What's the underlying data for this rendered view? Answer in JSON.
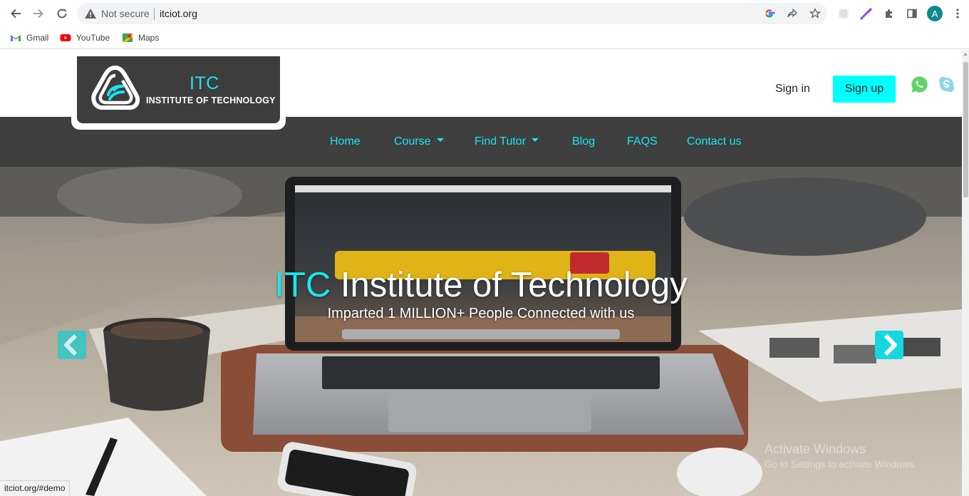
{
  "browser": {
    "not_secure_label": "Not secure",
    "url": "itciot.org",
    "avatar_initial": "A",
    "bookmarks": [
      {
        "label": "Gmail",
        "icon": "gmail-icon"
      },
      {
        "label": "YouTube",
        "icon": "youtube-icon"
      },
      {
        "label": "Maps",
        "icon": "maps-icon"
      }
    ],
    "status_url": "itciot.org/#demo"
  },
  "site": {
    "logo": {
      "title": "ITC",
      "subtitle": "INSTITUTE OF TECHNOLOGY"
    },
    "header": {
      "signin_label": "Sign in",
      "signup_label": "Sign up"
    },
    "nav": [
      {
        "label": "Home",
        "dropdown": false
      },
      {
        "label": "Course",
        "dropdown": true
      },
      {
        "label": "Find Tutor",
        "dropdown": true
      },
      {
        "label": "Blog",
        "dropdown": false
      },
      {
        "label": "FAQS",
        "dropdown": false
      },
      {
        "label": "Contact us",
        "dropdown": false
      }
    ],
    "hero": {
      "title_accent": "ITC",
      "title_rest": " Institute of Technology",
      "subtitle": "Imparted 1 MILLION+ People Connected with us"
    },
    "colors": {
      "accent": "#19e6f0",
      "signup_bg": "#00ffff",
      "navbar_bg": "#3f3f3f",
      "logo_bg": "#3e3d3d"
    }
  },
  "os": {
    "activate_title": "Activate Windows",
    "activate_sub": "Go to Settings to activate Windows."
  }
}
